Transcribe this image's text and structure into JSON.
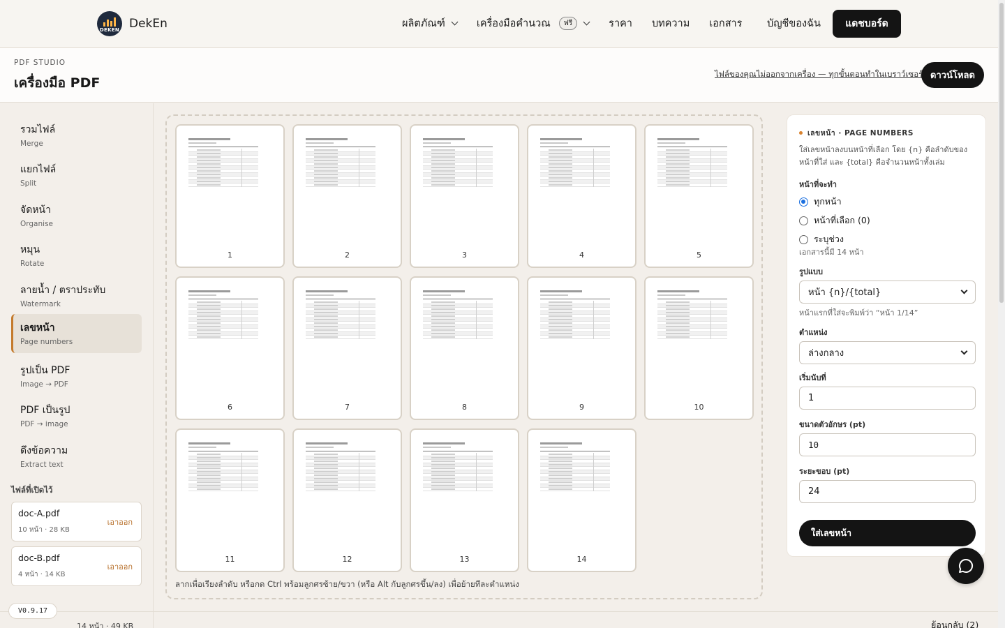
{
  "nav": {
    "brand": "DekEn",
    "logo_text": "DEKEN",
    "products": "ผลิตภัณฑ์",
    "calculators": "เครื่องมือคำนวณ",
    "free_badge": "ฟรี",
    "pricing": "ราคา",
    "articles": "บทความ",
    "docs": "เอกสาร",
    "account": "บัญชีของฉัน",
    "dashboard": "แดชบอร์ด"
  },
  "header": {
    "label": "PDF STUDIO",
    "title": "เครื่องมือ PDF",
    "privacy": "ไฟล์ของคุณไม่ออกจากเครื่อง — ทุกขั้นตอนทำในเบราว์เซอร์นี้",
    "download": "ดาวน์โหลด"
  },
  "sidebar": {
    "tools": [
      {
        "title": "รวมไฟล์",
        "sub": "Merge"
      },
      {
        "title": "แยกไฟล์",
        "sub": "Split"
      },
      {
        "title": "จัดหน้า",
        "sub": "Organise"
      },
      {
        "title": "หมุน",
        "sub": "Rotate"
      },
      {
        "title": "ลายน้ำ / ตราประทับ",
        "sub": "Watermark"
      },
      {
        "title": "เลขหน้า",
        "sub": "Page numbers"
      },
      {
        "title": "รูปเป็น PDF",
        "sub": "Image → PDF"
      },
      {
        "title": "PDF เป็นรูป",
        "sub": "PDF → image"
      },
      {
        "title": "ดึงข้อความ",
        "sub": "Extract text"
      }
    ],
    "open_files_label": "ไฟล์ที่เปิดไว้",
    "files": [
      {
        "name": "doc-A.pdf",
        "meta": "10 หน้า · 28 KB",
        "remove": "เอาออก"
      },
      {
        "name": "doc-B.pdf",
        "meta": "4 หน้า · 14 KB",
        "remove": "เอาออก"
      }
    ],
    "version": "V0.9.17"
  },
  "canvas": {
    "pages": [
      "1",
      "2",
      "3",
      "4",
      "5",
      "6",
      "7",
      "8",
      "9",
      "10",
      "11",
      "12",
      "13",
      "14"
    ],
    "hint": "ลากเพื่อเรียงลำดับ หรือกด Ctrl พร้อมลูกศรซ้าย/ขวา (หรือ Alt กับลูกศรขึ้น/ลง) เพื่อย้ายทีละตำแหน่ง"
  },
  "panel": {
    "title": "เลขหน้า · PAGE NUMBERS",
    "desc": "ใส่เลขหน้าลงบนหน้าที่เลือก โดย {n} คือลำดับของหน้าที่ใส่ และ {total} คือจำนวนหน้าทั้งเล่ม",
    "pages_label": "หน้าที่จะทำ",
    "opt_all": "ทุกหน้า",
    "opt_selected": "หน้าที่เลือก (0)",
    "opt_range": "ระบุช่วง",
    "doc_count": "เอกสารนี้มี 14 หน้า",
    "format_label": "รูปแบบ",
    "format_value": "หน้า {n}/{total}",
    "format_preview": "หน้าแรกที่ใส่จะพิมพ์ว่า “หน้า 1/14”",
    "position_label": "ตำแหน่ง",
    "position_value": "ล่างกลาง",
    "start_label": "เริ่มนับที่",
    "start_value": "1",
    "size_label": "ขนาดตัวอักษร (pt)",
    "size_value": "10",
    "margin_label": "ระยะขอบ (pt)",
    "margin_value": "24",
    "apply": "ใส่เลขหน้า"
  },
  "footer": {
    "summary": "14 หน้า · 49 KB",
    "undo": "ย้อนกลับ (2)"
  },
  "colors": {
    "accent": "#c47a2c",
    "primary_button": "#141414",
    "radio_checked": "#1a6fe0"
  }
}
